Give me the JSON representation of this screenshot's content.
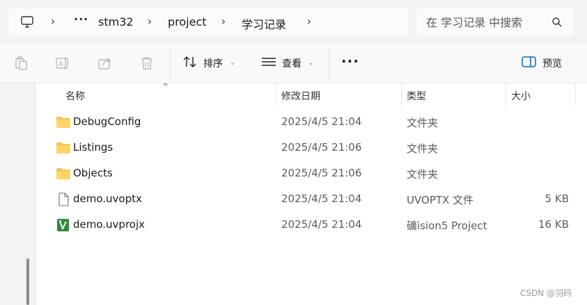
{
  "address_bar": {
    "root_icon": "this-pc-icon",
    "overflow": "···",
    "crumbs": [
      "stm32",
      "project",
      "学习记录"
    ]
  },
  "search": {
    "placeholder": "在 学习记录 中搜索",
    "icon": "search-icon"
  },
  "toolbar": {
    "icons": [
      "copy-icon",
      "rename-icon",
      "share-icon",
      "delete-icon"
    ],
    "sort_label": "排序",
    "view_label": "查看",
    "more_label": "···",
    "preview_label": "预览"
  },
  "columns": {
    "name": "名称",
    "modified": "修改日期",
    "type": "类型",
    "size": "大小"
  },
  "files": [
    {
      "name": "DebugConfig",
      "modified": "2025/4/5 21:04",
      "type": "文件夹",
      "size": "",
      "icon": "folder-icon"
    },
    {
      "name": "Listings",
      "modified": "2025/4/5 21:06",
      "type": "文件夹",
      "size": "",
      "icon": "folder-icon"
    },
    {
      "name": "Objects",
      "modified": "2025/4/5 21:06",
      "type": "文件夹",
      "size": "",
      "icon": "folder-icon"
    },
    {
      "name": "demo.uvoptx",
      "modified": "2025/4/5 21:04",
      "type": "UVOPTX 文件",
      "size": "5 KB",
      "icon": "file-icon"
    },
    {
      "name": "demo.uvprojx",
      "modified": "2025/4/5 21:04",
      "type": "礦ision5 Project",
      "size": "16 KB",
      "icon": "keil-project-icon"
    }
  ],
  "watermark": "CSDN @羽码",
  "colors": {
    "folder": "#f7c24a",
    "keil_icon": "#2e8b3a",
    "accent": "#0067c0"
  }
}
